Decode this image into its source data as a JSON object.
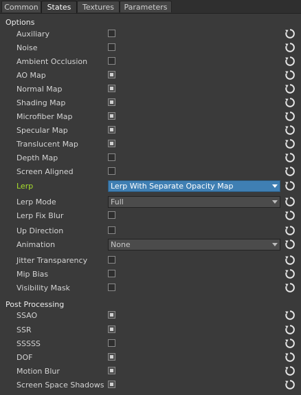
{
  "tabs": [
    {
      "label": "Common"
    },
    {
      "label": "States"
    },
    {
      "label": "Textures"
    },
    {
      "label": "Parameters"
    }
  ],
  "active_tab": "States",
  "colors": {
    "highlight_label": "#a9e02c",
    "dropdown_active": "#3f7fb3"
  },
  "sections": {
    "options": "Options",
    "post_processing": "Post Processing"
  },
  "options": [
    {
      "label": "Auxiliary",
      "type": "checkbox",
      "checked": false
    },
    {
      "label": "Noise",
      "type": "checkbox",
      "checked": false
    },
    {
      "label": "Ambient Occlusion",
      "type": "checkbox",
      "checked": false
    },
    {
      "label": "AO Map",
      "type": "checkbox",
      "checked": true
    },
    {
      "label": "Normal Map",
      "type": "checkbox",
      "checked": true
    },
    {
      "label": "Shading Map",
      "type": "checkbox",
      "checked": true
    },
    {
      "label": "Microfiber Map",
      "type": "checkbox",
      "checked": true
    },
    {
      "label": "Specular Map",
      "type": "checkbox",
      "checked": true
    },
    {
      "label": "Translucent Map",
      "type": "checkbox",
      "checked": true
    },
    {
      "label": "Depth Map",
      "type": "checkbox",
      "checked": false
    },
    {
      "label": "Screen Aligned",
      "type": "checkbox",
      "checked": false
    },
    {
      "label": "Lerp",
      "type": "dropdown",
      "value": "Lerp With Separate Opacity Map",
      "highlighted": true
    },
    {
      "label": "Lerp Mode",
      "type": "dropdown",
      "value": "Full"
    },
    {
      "label": "Lerp Fix Blur",
      "type": "checkbox",
      "checked": false
    },
    {
      "label": "Up Direction",
      "type": "checkbox",
      "checked": false
    },
    {
      "label": "Animation",
      "type": "dropdown",
      "value": "None"
    },
    {
      "label": "Jitter Transparency",
      "type": "checkbox",
      "checked": false
    },
    {
      "label": "Mip Bias",
      "type": "checkbox",
      "checked": false
    },
    {
      "label": "Visibility Mask",
      "type": "checkbox",
      "checked": false
    }
  ],
  "post_processing": [
    {
      "label": "SSAO",
      "type": "checkbox",
      "checked": true
    },
    {
      "label": "SSR",
      "type": "checkbox",
      "checked": true
    },
    {
      "label": "SSSSS",
      "type": "checkbox",
      "checked": false
    },
    {
      "label": "DOF",
      "type": "checkbox",
      "checked": true
    },
    {
      "label": "Motion Blur",
      "type": "checkbox",
      "checked": true
    },
    {
      "label": "Screen Space Shadows",
      "type": "checkbox",
      "checked": true
    }
  ],
  "reset_icon": "reset-icon"
}
